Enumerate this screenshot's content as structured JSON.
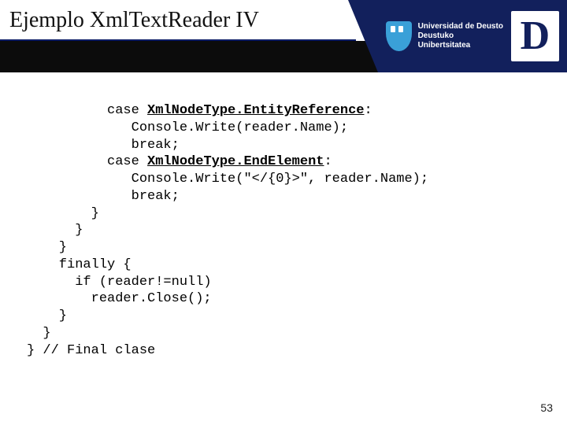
{
  "title": "Ejemplo XmlTextReader IV",
  "logo": {
    "line1": "Universidad de Deusto",
    "line2": "Deustuko Unibertsitatea",
    "letter": "D"
  },
  "code": {
    "l01a": "          case ",
    "l01b": "XmlNodeType.EntityReference",
    "l01c": ":",
    "l02": "             Console.Write(reader.Name);",
    "l03": "             break;",
    "l04a": "          case ",
    "l04b": "XmlNodeType.EndElement",
    "l04c": ":",
    "l05": "             Console.Write(\"</{0}>\", reader.Name);",
    "l06": "             break;",
    "l07": "        }",
    "l08": "      }",
    "l09": "    }",
    "l10": "    finally {",
    "l11": "      if (reader!=null)",
    "l12": "        reader.Close();",
    "l13": "    }",
    "l14": "  }",
    "l15": "} // Final clase"
  },
  "page_number": "53"
}
